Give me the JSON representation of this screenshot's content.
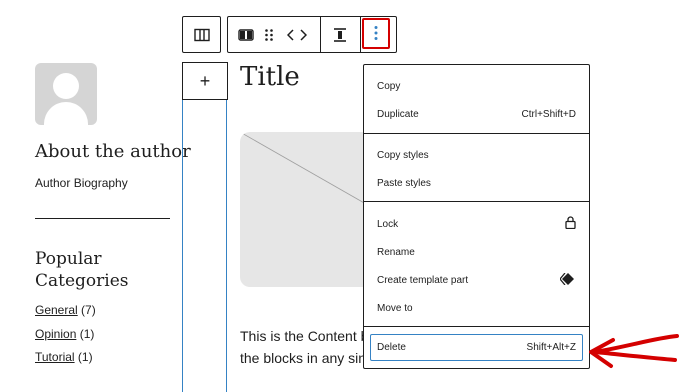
{
  "sidebar": {
    "about_heading": "About the author",
    "bio": "Author Biography",
    "popular_heading": "Popular Categories",
    "categories": [
      {
        "name": "General",
        "count": "(7)"
      },
      {
        "name": "Opinion",
        "count": "(1)"
      },
      {
        "name": "Tutorial",
        "count": "(1)"
      }
    ]
  },
  "toolbar": {
    "buttons": [
      "columns-icon",
      "block-type-icon",
      "drag-handle-icon",
      "move-arrows-icon",
      "align-icon",
      "more-options-icon"
    ]
  },
  "inserter": {
    "label": "+"
  },
  "main": {
    "title": "Title",
    "content_line1": "This is the Content b",
    "content_line2": "the blocks in any sin"
  },
  "menu": {
    "items": [
      {
        "label": "Copy",
        "shortcut": ""
      },
      {
        "label": "Duplicate",
        "shortcut": "Ctrl+Shift+D"
      },
      {
        "label": "Copy styles",
        "shortcut": ""
      },
      {
        "label": "Paste styles",
        "shortcut": ""
      },
      {
        "label": "Lock",
        "shortcut": "",
        "icon": "lock-icon"
      },
      {
        "label": "Rename",
        "shortcut": ""
      },
      {
        "label": "Create template part",
        "shortcut": "",
        "icon": "template-part-icon"
      },
      {
        "label": "Move to",
        "shortcut": ""
      },
      {
        "label": "Delete",
        "shortcut": "Shift+Alt+Z"
      }
    ]
  },
  "colors": {
    "accent": "#3582c4",
    "highlight": "#d40000",
    "text": "#1e1e1e",
    "placeholder": "#e6e6e6"
  }
}
